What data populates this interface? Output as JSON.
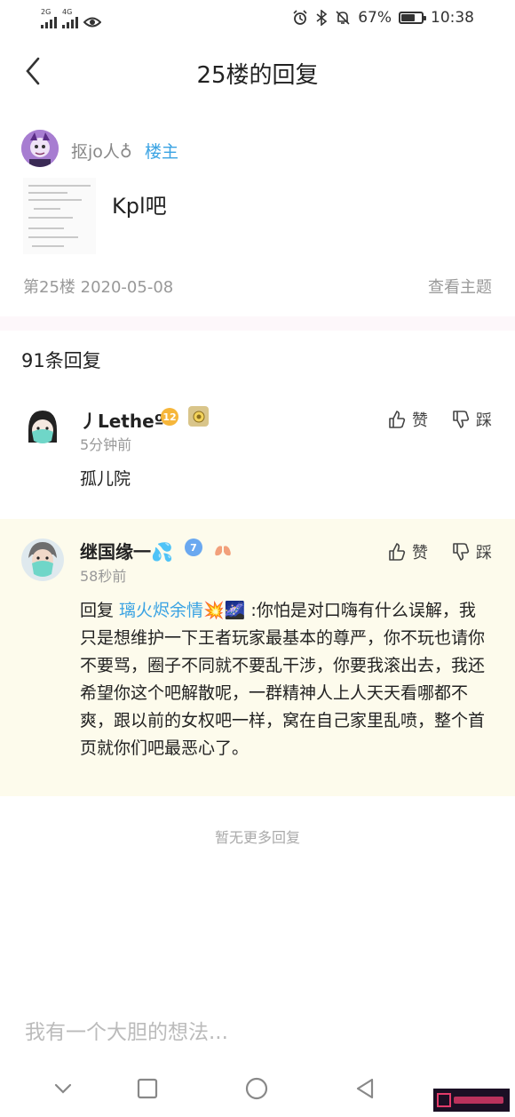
{
  "status_bar": {
    "network1": "2G",
    "network2": "4G",
    "battery_percent": "67%",
    "battery_level": 0.67,
    "time": "10:38"
  },
  "nav": {
    "title": "25楼的回复"
  },
  "post": {
    "author": "抠jo人♁",
    "badge": "楼主",
    "text": "Kpl吧",
    "floor_info": "第25楼  2020-05-08",
    "view_topic": "查看主题"
  },
  "reply_count": "91条回复",
  "comments": [
    {
      "name": "丿Letheº",
      "level": "12",
      "time": "5分钟前",
      "body": "孤儿院",
      "like_label": "赞",
      "dislike_label": "踩"
    },
    {
      "name": "继国缘一💦",
      "level": "7",
      "time": "58秒前",
      "reply_prefix": "回复 ",
      "mention": "璃火烬余情💥🌌",
      "body": " :你怕是对口嗨有什么误解，我只是想维护一下王者玩家最基本的尊严，你不玩也请你不要骂，圈子不同就不要乱干涉，你要我滚出去，我还希望你这个吧解散呢，一群精神人上人天天看哪都不爽，跟以前的女权吧一样，窝在自己家里乱喷，整个首页就你们吧最恶心了。",
      "like_label": "赞",
      "dislike_label": "踩"
    }
  ],
  "no_more": "暂无更多回复",
  "input": {
    "placeholder": "我有一个大胆的想法..."
  },
  "colors": {
    "accent": "#3aa3e3",
    "highlight_bg": "#fdfbec"
  }
}
